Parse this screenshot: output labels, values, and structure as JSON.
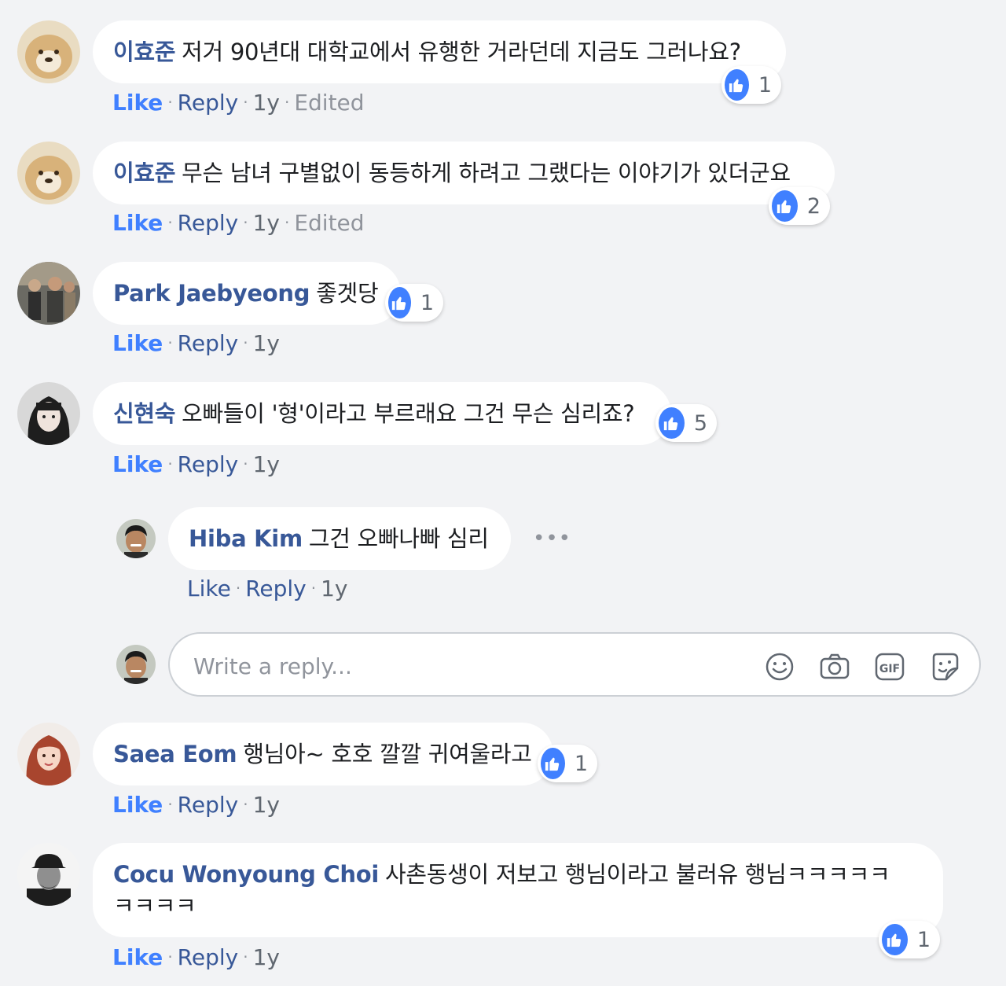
{
  "comments": [
    {
      "author": "이효준",
      "text": "저거 90년대 대학교에서 유행한 거라던데 지금도 그러나요?",
      "reactions": "1",
      "like": "Like",
      "reply": "Reply",
      "time": "1y",
      "edited": "Edited"
    },
    {
      "author": "이효준",
      "text": "무슨 남녀 구별없이 동등하게 하려고 그랬다는 이야기가 있더군요",
      "reactions": "2",
      "like": "Like",
      "reply": "Reply",
      "time": "1y",
      "edited": "Edited"
    },
    {
      "author": "Park Jaebyeong",
      "text": "좋겟당",
      "reactions": "1",
      "like": "Like",
      "reply": "Reply",
      "time": "1y"
    },
    {
      "author": "신현숙",
      "text": "오빠들이 '형'이라고 부르래요 그건 무슨 심리죠?",
      "reactions": "5",
      "like": "Like",
      "reply": "Reply",
      "time": "1y"
    },
    {
      "author": "Saea Eom",
      "text": "행님아~ 호호 깔깔 귀여울라고",
      "reactions": "1",
      "like": "Like",
      "reply": "Reply",
      "time": "1y"
    },
    {
      "author": "Cocu Wonyoung Choi",
      "text": "사촌동생이 저보고 행님이라고 불러유 행님ㅋㅋㅋㅋㅋ",
      "text_line2": "ㅋㅋㅋㅋ",
      "reactions": "1",
      "like": "Like",
      "reply": "Reply",
      "time": "1y"
    }
  ],
  "nested_reply": {
    "author": "Hiba Kim",
    "text": "그건 오빠나빠 심리",
    "like": "Like",
    "reply": "Reply",
    "time": "1y",
    "more": "•••"
  },
  "reply_box": {
    "placeholder": "Write a reply...",
    "icons": [
      "emoji-icon",
      "camera-icon",
      "gif-icon",
      "sticker-icon"
    ]
  },
  "colors": {
    "background": "#f2f3f5",
    "author_link": "#385898",
    "like_active": "#4080ff",
    "reaction_blue": "#4080ff"
  }
}
